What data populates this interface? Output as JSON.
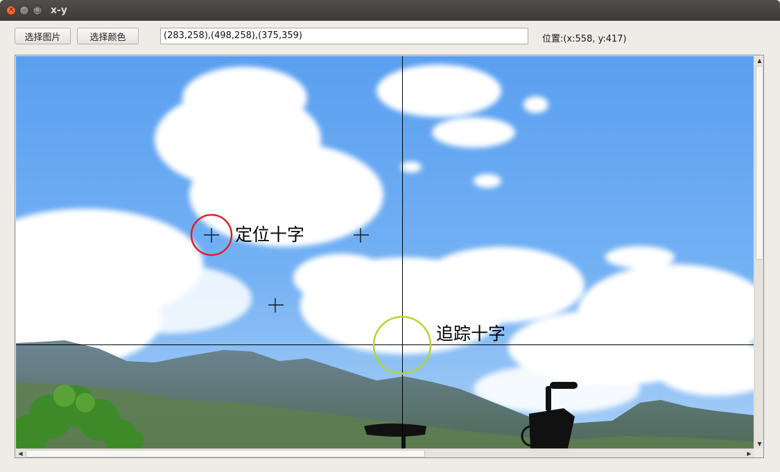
{
  "window": {
    "title": "x-y"
  },
  "toolbar": {
    "select_image_label": "选择图片",
    "select_color_label": "选择颜色",
    "coords_value": "(283,258),(498,258),(375,359)",
    "position_label": "位置:(x:558, y:417)"
  },
  "canvas": {
    "locate_cross_label": "定位十字",
    "track_cross_label": "追踪十字",
    "locate_circle_color": "#e0202c",
    "track_circle_color": "#b6d62a"
  },
  "icons": {
    "close": "close-icon",
    "minimize": "minimize-icon",
    "maximize": "maximize-icon",
    "scroll_up": "arrow-up-icon",
    "scroll_down": "arrow-down-icon",
    "scroll_left": "arrow-left-icon",
    "scroll_right": "arrow-right-icon"
  }
}
